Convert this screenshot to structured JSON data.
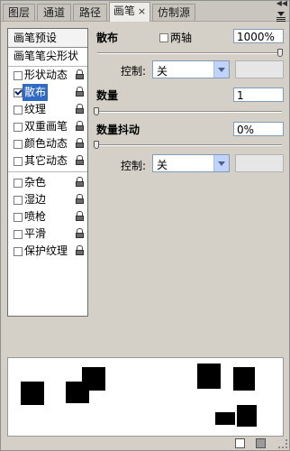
{
  "tabs": [
    {
      "label": "图层",
      "active": false
    },
    {
      "label": "通道",
      "active": false
    },
    {
      "label": "路径",
      "active": false
    },
    {
      "label": "画笔",
      "active": true,
      "close": "×"
    },
    {
      "label": "仿制源",
      "active": false
    }
  ],
  "collapse_glyph": "◀◀",
  "left": {
    "preset": "画笔预设",
    "tip": "画笔笔尖形状",
    "items": [
      {
        "label": "形状动态",
        "checked": false,
        "lock": true
      },
      {
        "label": "散布",
        "checked": true,
        "lock": true,
        "selected": true
      },
      {
        "label": "纹理",
        "checked": false,
        "lock": true
      },
      {
        "label": "双重画笔",
        "checked": false,
        "lock": true
      },
      {
        "label": "颜色动态",
        "checked": false,
        "lock": true
      },
      {
        "label": "其它动态",
        "checked": false,
        "lock": true
      },
      {
        "label": "杂色",
        "checked": false,
        "lock": true
      },
      {
        "label": "湿边",
        "checked": false,
        "lock": true
      },
      {
        "label": "喷枪",
        "checked": false,
        "lock": true
      },
      {
        "label": "平滑",
        "checked": false,
        "lock": true
      },
      {
        "label": "保护纹理",
        "checked": false,
        "lock": true
      }
    ]
  },
  "scatter": {
    "label": "散布",
    "both_axes_label": "两轴",
    "value": "1000%",
    "slider_fraction": 1.0,
    "control_label": "控制:",
    "control_value": "关"
  },
  "count": {
    "label": "数量",
    "value": "1",
    "slider_fraction": 0.0
  },
  "count_jitter": {
    "label": "数量抖动",
    "value": "0%",
    "slider_fraction": 0.0,
    "control_label": "控制:",
    "control_value": "关"
  },
  "icons": {
    "menu": "panel-menu-icon",
    "lock": "lock-icon",
    "new": "new-brush-icon",
    "delete": "trash-icon"
  }
}
